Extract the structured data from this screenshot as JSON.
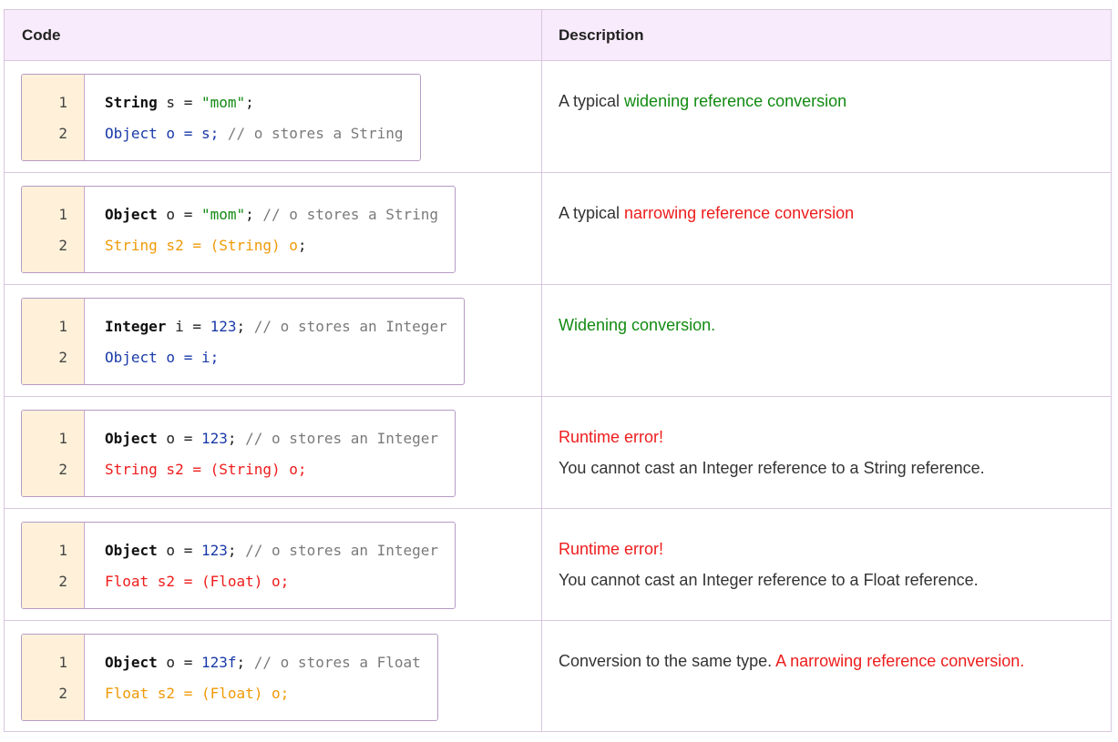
{
  "table": {
    "header": {
      "code": "Code",
      "description": "Description"
    },
    "rows": [
      {
        "line_numbers": [
          "1",
          "2"
        ],
        "code": [
          [
            {
              "t": "String",
              "s": "kw"
            },
            {
              "t": " s = ",
              "s": "plain"
            },
            {
              "t": "\"mom\"",
              "s": "str"
            },
            {
              "t": ";",
              "s": "plain"
            }
          ],
          [
            {
              "t": "Object o = s; ",
              "s": "blue"
            },
            {
              "t": "// o stores a String",
              "s": "cmt"
            }
          ]
        ],
        "description": [
          [
            {
              "t": "A typical ",
              "s": "plain"
            },
            {
              "t": "widening reference conversion",
              "s": "green"
            }
          ]
        ]
      },
      {
        "line_numbers": [
          "1",
          "2"
        ],
        "code": [
          [
            {
              "t": "Object",
              "s": "kw"
            },
            {
              "t": " o = ",
              "s": "plain"
            },
            {
              "t": "\"mom\"",
              "s": "str"
            },
            {
              "t": "; ",
              "s": "plain"
            },
            {
              "t": "// o stores a String",
              "s": "cmt"
            }
          ],
          [
            {
              "t": "String s2 = (String) o",
              "s": "orange"
            },
            {
              "t": ";",
              "s": "plain"
            }
          ]
        ],
        "description": [
          [
            {
              "t": "A typical ",
              "s": "plain"
            },
            {
              "t": "narrowing reference conversion",
              "s": "red"
            }
          ]
        ]
      },
      {
        "line_numbers": [
          "1",
          "2"
        ],
        "code": [
          [
            {
              "t": "Integer",
              "s": "kw"
            },
            {
              "t": " i = ",
              "s": "plain"
            },
            {
              "t": "123",
              "s": "num"
            },
            {
              "t": "; ",
              "s": "plain"
            },
            {
              "t": "// o stores an Integer",
              "s": "cmt"
            }
          ],
          [
            {
              "t": "Object o = i;",
              "s": "blue"
            }
          ]
        ],
        "description": [
          [
            {
              "t": "Widening conversion.",
              "s": "green"
            }
          ]
        ]
      },
      {
        "line_numbers": [
          "1",
          "2"
        ],
        "code": [
          [
            {
              "t": "Object",
              "s": "kw"
            },
            {
              "t": " o = ",
              "s": "plain"
            },
            {
              "t": "123",
              "s": "num"
            },
            {
              "t": "; ",
              "s": "plain"
            },
            {
              "t": "// o stores an Integer",
              "s": "cmt"
            }
          ],
          [
            {
              "t": "String s2 = (String) o;",
              "s": "red"
            }
          ]
        ],
        "description": [
          [
            {
              "t": "Runtime error!",
              "s": "red"
            }
          ],
          [
            {
              "t": "You cannot cast an Integer reference to a String reference.",
              "s": "plain"
            }
          ]
        ]
      },
      {
        "line_numbers": [
          "1",
          "2"
        ],
        "code": [
          [
            {
              "t": "Object",
              "s": "kw"
            },
            {
              "t": " o = ",
              "s": "plain"
            },
            {
              "t": "123",
              "s": "num"
            },
            {
              "t": "; ",
              "s": "plain"
            },
            {
              "t": "// o stores an Integer",
              "s": "cmt"
            }
          ],
          [
            {
              "t": "Float s2 = (Float) o;",
              "s": "red"
            }
          ]
        ],
        "description": [
          [
            {
              "t": "Runtime error!",
              "s": "red"
            }
          ],
          [
            {
              "t": "You cannot cast an Integer reference to a Float reference.",
              "s": "plain"
            }
          ]
        ]
      },
      {
        "line_numbers": [
          "1",
          "2"
        ],
        "code": [
          [
            {
              "t": "Object",
              "s": "kw"
            },
            {
              "t": " o = ",
              "s": "plain"
            },
            {
              "t": "123f",
              "s": "num"
            },
            {
              "t": "; ",
              "s": "plain"
            },
            {
              "t": "// o stores a Float",
              "s": "cmt"
            }
          ],
          [
            {
              "t": "Float s2 = (Float) o;",
              "s": "orange"
            }
          ]
        ],
        "description": [
          [
            {
              "t": "Conversion to the same type. ",
              "s": "plain"
            },
            {
              "t": "A narrowing reference conversion.",
              "s": "red"
            }
          ]
        ]
      }
    ]
  },
  "colors": {
    "header_bg": "#f8ebfb",
    "border": "#d9c6df",
    "gutter_bg": "#fff1d9",
    "keyword": "#111111",
    "string": "#128a12",
    "number": "#1a3aa8",
    "comment": "#7a7a7a",
    "blue_code": "#1a3aa8",
    "orange_code": "#ef9a08",
    "red": "#ee1c1c",
    "green": "#128a12"
  }
}
